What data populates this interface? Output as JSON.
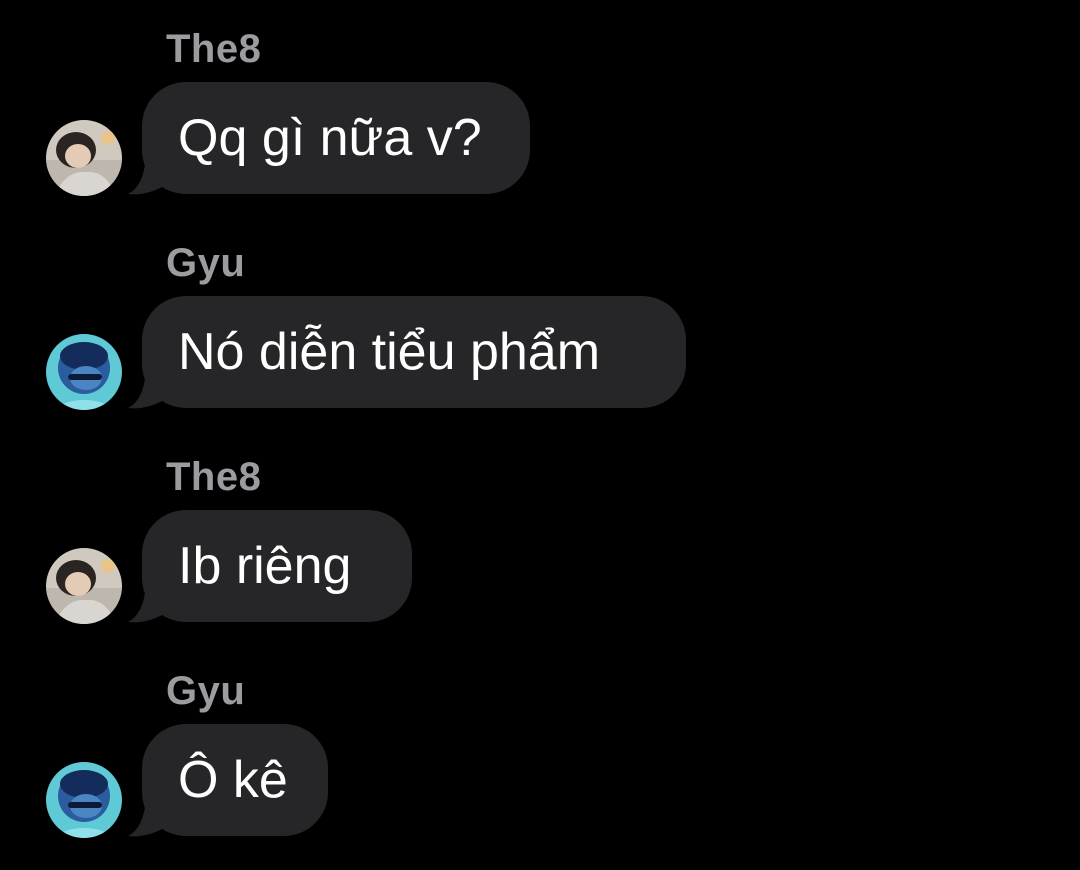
{
  "messages": [
    {
      "sender": "The8",
      "text": "Qq gì nữa v?",
      "avatar_icon": "person-hood-avatar-icon"
    },
    {
      "sender": "Gyu",
      "text": "Nó diễn tiểu phẩm",
      "avatar_icon": "blue-tinted-avatar-icon"
    },
    {
      "sender": "The8",
      "text": "Ib riêng",
      "avatar_icon": "person-hood-avatar-icon"
    },
    {
      "sender": "Gyu",
      "text": "Ô kê",
      "avatar_icon": "blue-tinted-avatar-icon"
    }
  ],
  "colors": {
    "background": "#000000",
    "bubble": "#262629",
    "sender_name": "#9b9ba0",
    "message_text": "#ffffff"
  }
}
